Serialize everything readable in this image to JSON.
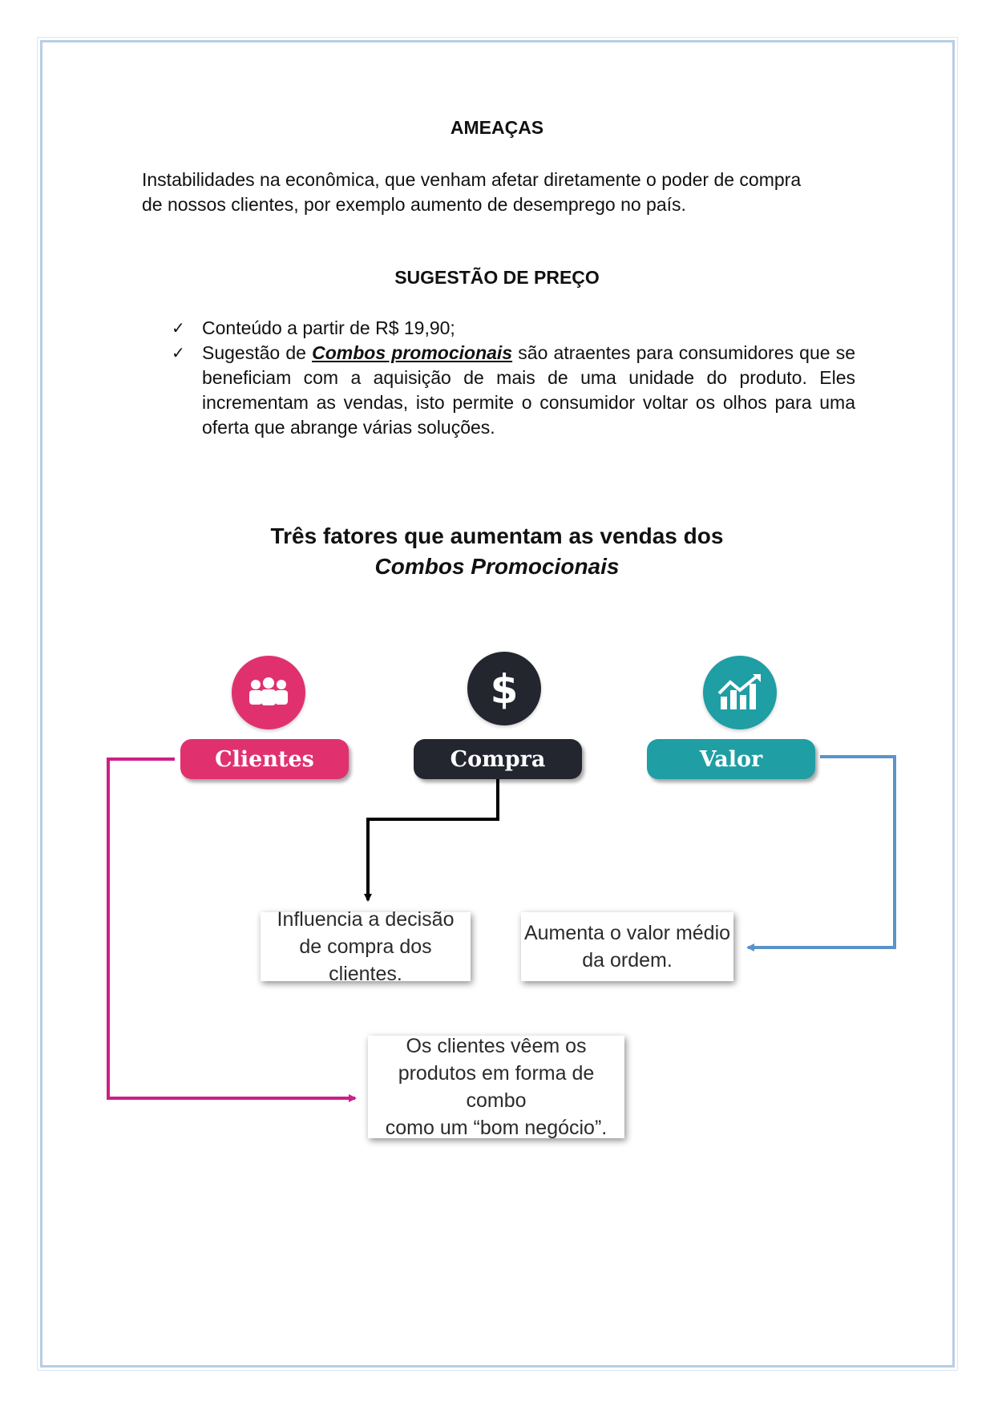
{
  "threats": {
    "heading": "AMEAÇAS",
    "line1": "Instabilidades na econômica, que venham afetar diretamente o poder de compra",
    "line2": "de nossos clientes, por exemplo aumento de desemprego no país."
  },
  "price": {
    "heading": "SUGESTÃO DE PREÇO",
    "items": [
      {
        "text": "Conteúdo a partir de R$ 19,90;"
      },
      {
        "prefix": "Sugestão de ",
        "emphasis": "Combos promocionais",
        "suffix": " são atraentes para consumidores que se beneficiam com a aquisição de mais de uma unidade do produto. Eles incrementam as vendas, isto permite o consumidor voltar os olhos para uma oferta que abrange várias soluções."
      }
    ]
  },
  "diagram": {
    "title_line1": "Três fatores que aumentam as vendas dos",
    "title_line2": "Combos Promocionais",
    "factors": [
      {
        "label": "Clientes",
        "color": "#e0316e",
        "icon": "people-icon"
      },
      {
        "label": "Compra",
        "color": "#23262f",
        "icon": "dollar-icon"
      },
      {
        "label": "Valor",
        "color": "#1f9ea4",
        "icon": "growth-chart-icon"
      }
    ],
    "boxes": {
      "compra": [
        "Influencia a decisão",
        "de compra dos clientes."
      ],
      "valor": [
        "Aumenta o valor médio",
        "da ordem."
      ],
      "clientes": [
        "Os clientes vêem os",
        "produtos em forma de combo",
        "como um “bom negócio”."
      ]
    },
    "arrow_colors": {
      "clientes": "#cc1f87",
      "compra": "#000000",
      "valor": "#5b93c7"
    }
  }
}
